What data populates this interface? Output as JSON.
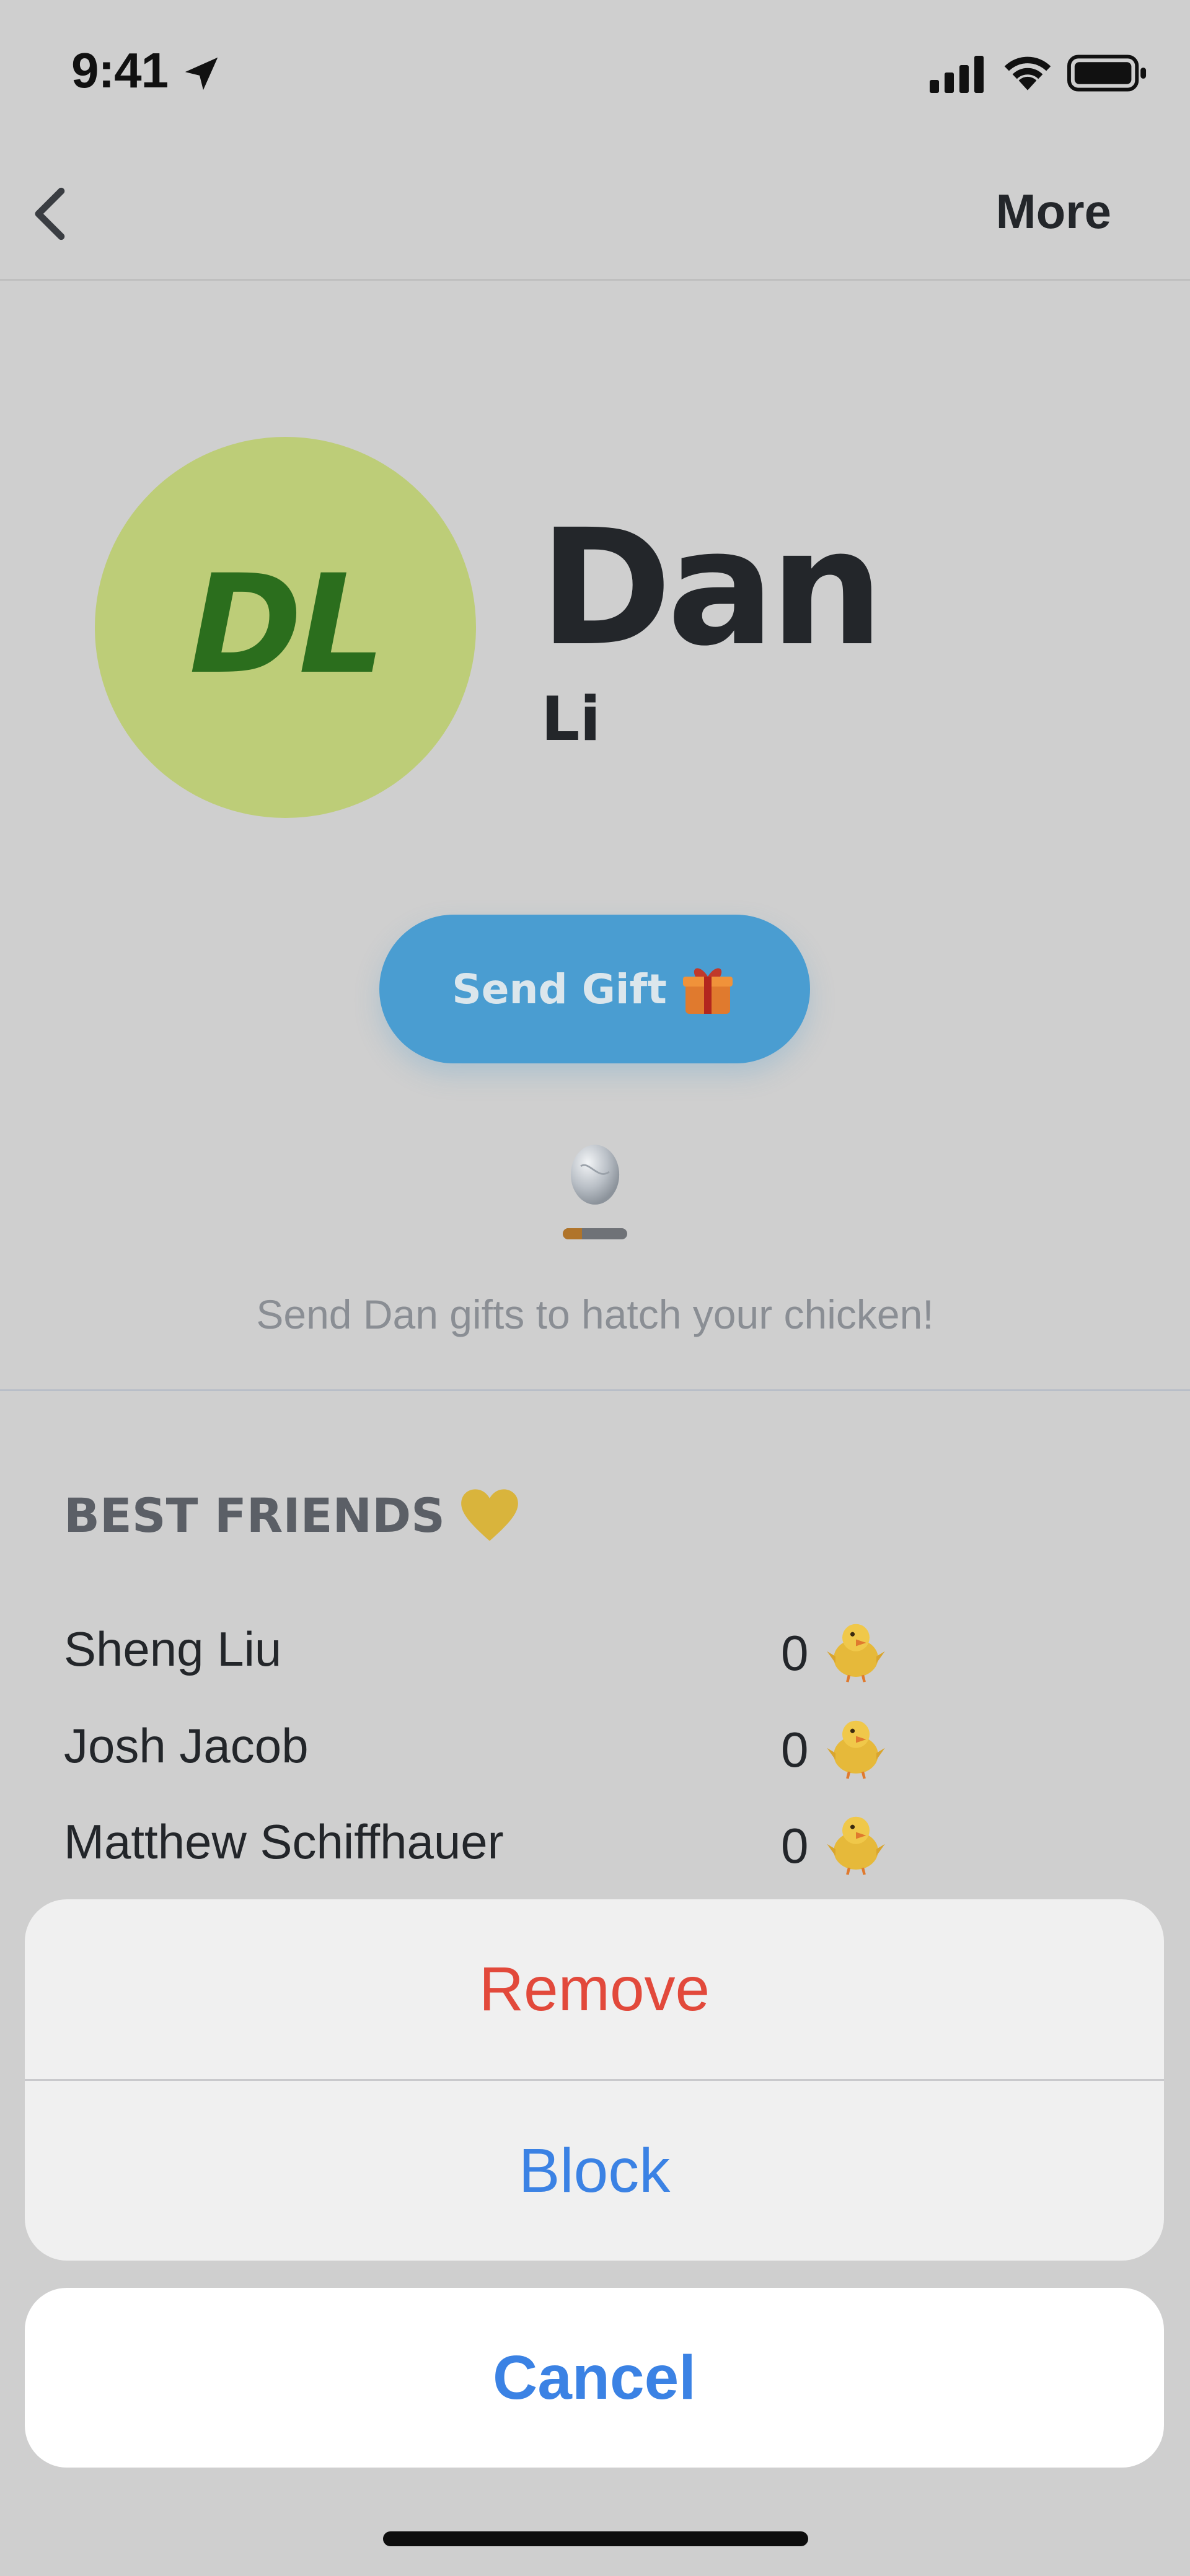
{
  "status_bar": {
    "time": "9:41",
    "icons": [
      "location-arrow-icon",
      "cellular-signal-icon",
      "wifi-icon",
      "battery-icon"
    ]
  },
  "nav": {
    "back_icon": "chevron-left-icon",
    "more_label": "More"
  },
  "profile": {
    "initials": "DL",
    "first_name": "Dan",
    "last_name": "Li",
    "avatar_color": "#bdcd78",
    "initials_color": "#2b6e1d"
  },
  "gift": {
    "button_label": "Send Gift",
    "button_icon": "gift-icon",
    "button_color": "#4a9dd1"
  },
  "egg": {
    "icon": "egg-icon",
    "progress": 0.3,
    "hatch_text": "Send Dan gifts to hatch your chicken!"
  },
  "best_friends": {
    "title": "BEST FRIENDS",
    "title_icon": "yellow-heart-icon",
    "rows": [
      {
        "name": "Sheng Liu",
        "count": "0",
        "icon": "chick-icon"
      },
      {
        "name": "Josh Jacob",
        "count": "0",
        "icon": "chick-icon"
      },
      {
        "name": "Matthew Schiffhauer",
        "count": "0",
        "icon": "chick-icon"
      }
    ]
  },
  "action_sheet": {
    "remove_label": "Remove",
    "block_label": "Block",
    "cancel_label": "Cancel",
    "destructive_color": "#e2493b",
    "accent_color": "#3b82e4"
  }
}
